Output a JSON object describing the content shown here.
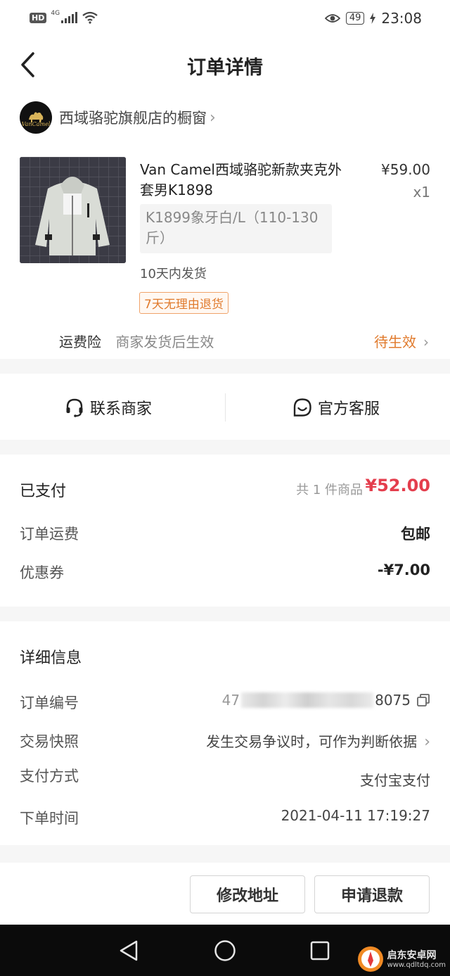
{
  "status_bar": {
    "hd": "HD",
    "network": "4G",
    "battery": "49",
    "time": "23:08"
  },
  "nav": {
    "title": "订单详情"
  },
  "shop": {
    "logo_text": "VanCamel",
    "name": "西域骆驼旗舰店的橱窗"
  },
  "product": {
    "title": "Van Camel西域骆驼新款夹克外套男K1898",
    "price": "¥59.00",
    "quantity": "x1",
    "sku": "K1899象牙白/L（110-130斤）",
    "shipping_time": "10天内发货",
    "return_tag": "7天无理由退货"
  },
  "insurance": {
    "label": "运费险",
    "desc": "商家发货后生效",
    "status": "待生效"
  },
  "service": {
    "contact_merchant": "联系商家",
    "official_service": "官方客服"
  },
  "payment": {
    "label": "已支付",
    "count_text": "共 1 件商品",
    "amount": "¥52.00",
    "freight_label": "订单运费",
    "freight_value": "包邮",
    "coupon_label": "优惠券",
    "coupon_value": "-¥7.00"
  },
  "details": {
    "title": "详细信息",
    "order_no_label": "订单编号",
    "order_no_prefix": "47",
    "order_no_suffix": "8075",
    "snapshot_label": "交易快照",
    "snapshot_value": "发生交易争议时，可作为判断依据",
    "pay_method_label": "支付方式",
    "pay_method_value": "支付宝支付",
    "order_time_label": "下单时间",
    "order_time_value": "2021-04-11 17:19:27"
  },
  "actions": {
    "modify_address": "修改地址",
    "apply_refund": "申请退款"
  },
  "watermark": {
    "text": "启东安卓网",
    "url": "www.qdltdq.com"
  },
  "colors": {
    "accent_red": "#e43e4d",
    "accent_orange": "#e07a2c",
    "sysnav_bg": "#0b0b0b"
  }
}
